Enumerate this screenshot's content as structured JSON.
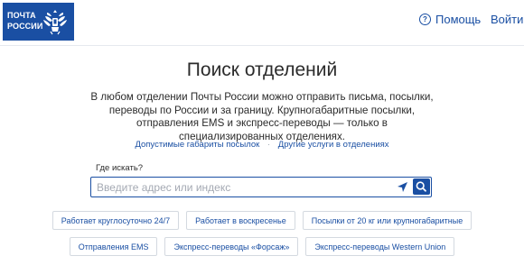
{
  "header": {
    "logo_text": "ПОЧТА\nРОССИИ",
    "help_icon_glyph": "?",
    "help_label": "Помощь",
    "login_label": "Войти"
  },
  "main": {
    "title": "Поиск отделений",
    "description": "В любом отделении Почты России можно отправить письма, посылки, переводы по России и за границу. Крупногабаритные посылки, отправления EMS и экспресс-переводы — только в специализированных отделениях.",
    "links": [
      {
        "label": "Допустимые габариты посылок"
      },
      {
        "label": "Другие услуги в отделениях"
      }
    ],
    "links_separator": "·",
    "search": {
      "label": "Где искать?",
      "placeholder": "Введите адрес или индекс",
      "value": ""
    },
    "filters_row1": [
      {
        "label": "Работает круглосуточно 24/7"
      },
      {
        "label": "Работает в воскресенье"
      },
      {
        "label": "Посылки от 20 кг или крупногабаритные"
      }
    ],
    "filters_row2": [
      {
        "label": "Отправления EMS"
      },
      {
        "label": "Экспресс-переводы «Форсаж»"
      },
      {
        "label": "Экспресс-переводы Western Union"
      }
    ]
  },
  "colors": {
    "brand": "#1a4fa3",
    "text": "#2b2b2b",
    "chip_border": "#d4d9e0"
  },
  "icons": {
    "logo_emblem": "double-headed-eagle-icon",
    "help": "question-circle-icon",
    "locate": "location-arrow-icon",
    "search": "magnifier-icon"
  }
}
